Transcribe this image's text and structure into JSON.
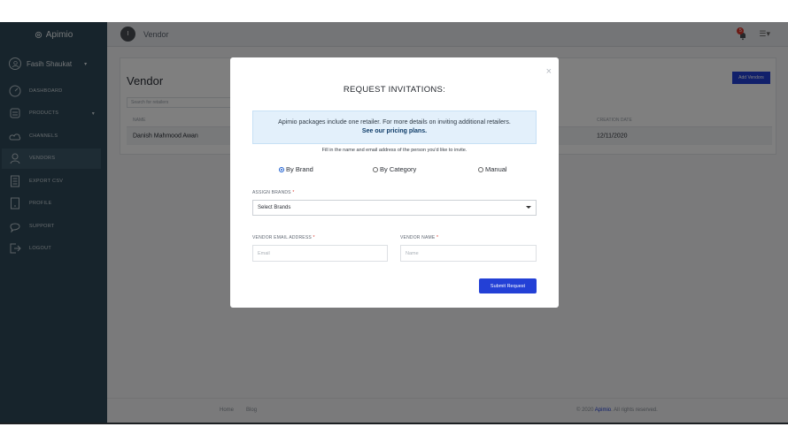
{
  "sidebar": {
    "brand": "Apimio",
    "user_name": "Fasih Shaukat",
    "items": [
      {
        "label": "DASHBOARD",
        "icon": "dashboard-icon"
      },
      {
        "label": "PRODUCTS",
        "icon": "products-icon"
      },
      {
        "label": "CHANNELS",
        "icon": "channels-icon"
      },
      {
        "label": "VENDORS",
        "icon": "vendors-icon"
      },
      {
        "label": "EXPORT CSV",
        "icon": "export-csv-icon"
      },
      {
        "label": "PROFILE",
        "icon": "profile-icon"
      },
      {
        "label": "SUPPORT",
        "icon": "support-icon"
      },
      {
        "label": "LOGOUT",
        "icon": "logout-icon"
      }
    ]
  },
  "topbar": {
    "avatar_letter": "I",
    "title": "Vendor",
    "notification_count": "5"
  },
  "page": {
    "title": "Vendor",
    "search_placeholder": "Search for retailers",
    "add_button": "Add Vendors",
    "columns": [
      "NAME",
      "CREATION DATE"
    ],
    "rows": [
      {
        "name": "Danish Mahmood Awan",
        "date": "12/11/2020"
      }
    ]
  },
  "footer": {
    "home": "Home",
    "blog": "Blog",
    "copyright_prefix": "© 2020",
    "copyright_brand": "Apimio",
    "copyright_suffix": ". All rights reserved."
  },
  "modal": {
    "close": "×",
    "title": "REQUEST INVITATIONS:",
    "notice_text": "Apimio packages include one retailer. For more details on inviting additional retailers.",
    "notice_link": "See our pricing plans.",
    "hint": "Fill in the name and email address of the person you'd like to invite.",
    "radio_options": [
      "By Brand",
      "By Category",
      "Manual"
    ],
    "selected_option": "By Brand",
    "assign_label": "ASSIGN BRANDS",
    "select_value": "Select Brands",
    "email_label": "VENDOR EMAIL ADDRESS",
    "email_placeholder": "Email",
    "name_label": "VENDOR NAME",
    "name_placeholder": "Name",
    "required_mark": "*",
    "submit_label": "Submit Request"
  },
  "colors": {
    "sidebar_bg": "#2f4858",
    "primary": "#2340d6",
    "notice_bg": "#e3f0fb",
    "badge": "#d9362b"
  }
}
